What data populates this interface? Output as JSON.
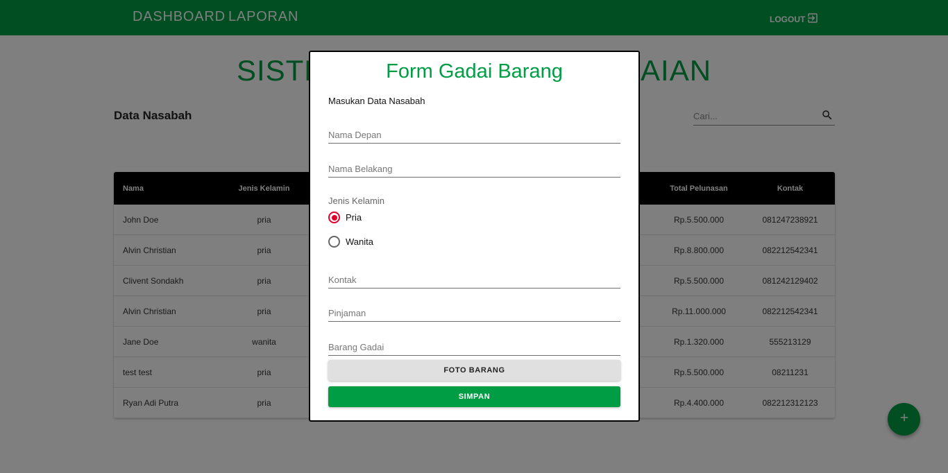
{
  "nav": {
    "dashboard": "DASHBOARD",
    "laporan": "LAPORAN",
    "logout": "LOGOUT"
  },
  "page": {
    "title": "SISTEM INFORMASI PEGADAIAN",
    "section_title": "Data Nasabah",
    "search_placeholder": "Cari..."
  },
  "table": {
    "headers": {
      "nama": "Nama",
      "jenis_kelamin": "Jenis Kelamin",
      "total_pelunasan": "Total Pelunasan",
      "kontak": "Kontak"
    },
    "rows": [
      {
        "nama": "John Doe",
        "jenis_kelamin": "pria",
        "total_pelunasan": "Rp.5.500.000",
        "kontak": "081247238921"
      },
      {
        "nama": "Alvin Christian",
        "jenis_kelamin": "pria",
        "total_pelunasan": "Rp.8.800.000",
        "kontak": "082212542341"
      },
      {
        "nama": "Clivent Sondakh",
        "jenis_kelamin": "pria",
        "total_pelunasan": "Rp.5.500.000",
        "kontak": "081242129402"
      },
      {
        "nama": "Alvin Christian",
        "jenis_kelamin": "pria",
        "total_pelunasan": "Rp.11.000.000",
        "kontak": "082212542341"
      },
      {
        "nama": "Jane Doe",
        "jenis_kelamin": "wanita",
        "total_pelunasan": "Rp.1.320.000",
        "kontak": "555213129"
      },
      {
        "nama": "test test",
        "jenis_kelamin": "pria",
        "total_pelunasan": "Rp.5.500.000",
        "kontak": "08211231"
      },
      {
        "nama": "Ryan Adi Putra",
        "jenis_kelamin": "pria",
        "total_pelunasan": "Rp.4.400.000",
        "kontak": "082212312123"
      }
    ]
  },
  "modal": {
    "title": "Form Gadai Barang",
    "subtitle": "Masukan Data Nasabah",
    "nama_depan_placeholder": "Nama Depan",
    "nama_belakang_placeholder": "Nama Belakang",
    "jenis_kelamin_label": "Jenis Kelamin",
    "options": {
      "pria": "Pria",
      "wanita": "Wanita"
    },
    "selected_option": "Pria",
    "kontak_placeholder": "Kontak",
    "pinjaman_placeholder": "Pinjaman",
    "barang_gadai_placeholder": "Barang Gadai",
    "foto_button": "FOTO BARANG",
    "simpan_button": "SIMPAN"
  },
  "colors": {
    "primary": "#009d44",
    "radio_checked": "#e0002b",
    "table_header": "#000000"
  },
  "icons": {
    "logout": "logout-icon",
    "search": "search-icon",
    "fab": "add-icon"
  }
}
